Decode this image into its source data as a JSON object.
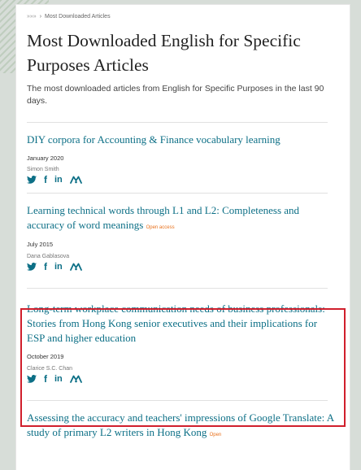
{
  "breadcrumb": {
    "home": "»»»",
    "separator": "›",
    "current": "Most Downloaded Articles"
  },
  "page": {
    "title": "Most Downloaded English for Specific Purposes Articles",
    "description": "The most downloaded articles from English for Specific Purposes in the last 90 days."
  },
  "articles": [
    {
      "title": "DIY corpora for Accounting & Finance vocabulary learning",
      "open_access": "",
      "date": "January 2020",
      "author": "Simon Smith"
    },
    {
      "title": "Learning technical words through L1 and L2: Completeness and accuracy of word meanings",
      "open_access": "Open access",
      "date": "July 2015",
      "author": "Dana Gablasova"
    },
    {
      "title": "Long-term workplace communication needs of business professionals: Stories from Hong Kong senior executives and their implications for ESP and higher education",
      "open_access": "",
      "date": "October 2019",
      "author": "Clarice S.C. Chan"
    },
    {
      "title": "Assessing the accuracy and teachers' impressions of Google Translate: A study of primary L2 writers in Hong Kong",
      "open_access": "Open",
      "date": "",
      "author": ""
    }
  ],
  "social": {
    "twitter": "twitter-icon",
    "facebook": "f",
    "linkedin": "in",
    "mendeley": "mendeley-icon"
  },
  "colors": {
    "link": "#0c6f86",
    "open_access": "#e9711c",
    "highlight": "#d01f2c"
  }
}
